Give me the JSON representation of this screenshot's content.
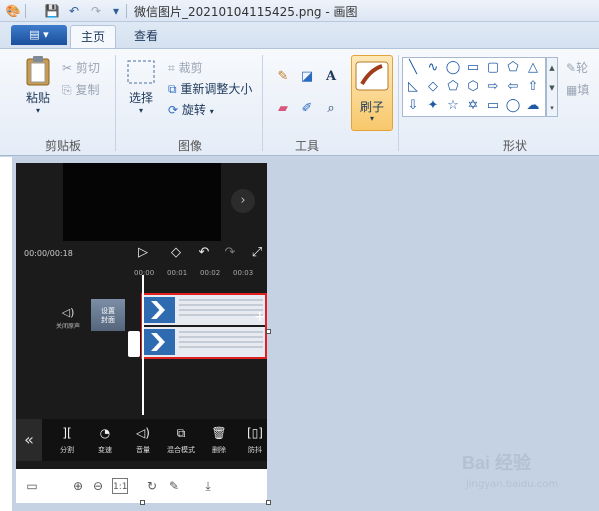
{
  "window": {
    "title": "微信图片_20210104115425.png - 画图"
  },
  "tabs": {
    "app_menu": "▤ ▾",
    "home": "主页",
    "view": "查看"
  },
  "ribbon": {
    "clipboard": {
      "group_label": "剪贴板",
      "paste": "粘贴",
      "cut": "剪切",
      "copy": "复制"
    },
    "image": {
      "group_label": "图像",
      "select": "选择",
      "crop": "裁剪",
      "resize": "重新调整大小",
      "rotate": "旋转"
    },
    "tools": {
      "group_label": "工具"
    },
    "brushes": {
      "label": "刷子"
    },
    "shapes": {
      "group_label": "形状",
      "outline": "轮",
      "fill": "填"
    }
  },
  "capture": {
    "time": "00:00/00:18",
    "ticks": [
      "00:00",
      "00:01",
      "00:02",
      "00:03"
    ],
    "mute_label": "关闭原声",
    "cover_label": "设置\n封面",
    "add": "+",
    "toolbar": {
      "collapse": "«",
      "items": [
        {
          "icon": "split-icon",
          "glyph": "][",
          "label": "分割"
        },
        {
          "icon": "speed-icon",
          "glyph": "◔",
          "label": "变速"
        },
        {
          "icon": "volume-icon",
          "glyph": "◁)",
          "label": "音量"
        },
        {
          "icon": "blend-icon",
          "glyph": "⧉",
          "label": "混合模式"
        },
        {
          "icon": "delete-icon",
          "glyph": "🗑",
          "label": "删除"
        },
        {
          "icon": "anti-shake-icon",
          "glyph": "[▯]",
          "label": "防抖"
        }
      ]
    }
  },
  "watermark": {
    "main": "Bai 经验",
    "url": "jingyan.baidu.com"
  },
  "colors": {
    "accent": "#2b6bc0",
    "selection": "#e02020",
    "brush_highlight": "#f8c86b"
  }
}
